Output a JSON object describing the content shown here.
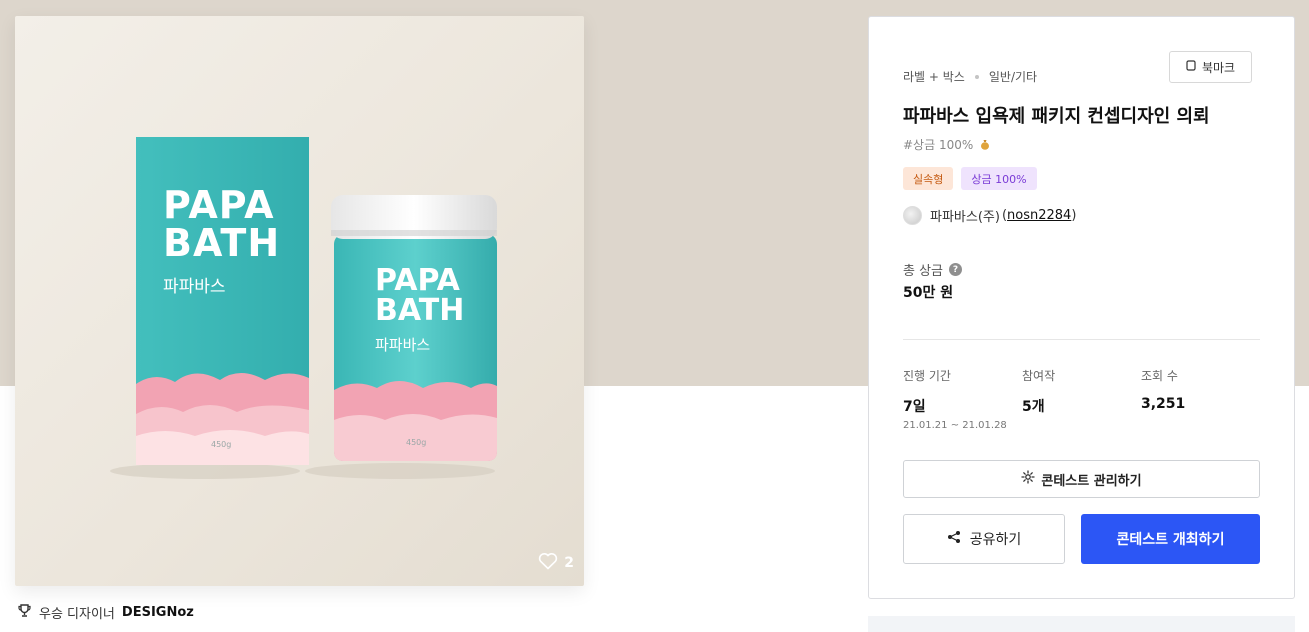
{
  "product": {
    "likes": "2",
    "winner_prefix": "우승 디자이너",
    "winner_name": "DESIGNoz",
    "box_brand_line1": "PAPA",
    "box_brand_line2": "BATH",
    "box_brand_korean": "파파바스",
    "box_weight": "450g"
  },
  "contest": {
    "category": "라벨 + 박스",
    "subcategory": "일반/기타",
    "bookmark_label": "북마크",
    "title": "파파바스 입욕제 패키지 컨셉디자인 의뢰",
    "hashtag": "#상금 100%",
    "tags": [
      "실속형",
      "상금 100%"
    ],
    "host_name": "파파바스(주)",
    "host_id_open": "(",
    "host_id": "nosn2284",
    "host_id_close": ")",
    "prize_label": "총 상금",
    "prize_value": "50만 원",
    "stats": [
      {
        "label": "진행 기간",
        "value": "7일",
        "sub": "21.01.21 ~ 21.01.28"
      },
      {
        "label": "참여작",
        "value": "5개"
      },
      {
        "label": "조회 수",
        "value": "3,251"
      }
    ],
    "manage_button": "콘테스트 관리하기",
    "share_button": "공유하기",
    "host_button": "콘테스트 개최하기"
  },
  "colors": {
    "hero_background": "#ddd6cc",
    "primary": "#2c56f5",
    "product_teal": "#3fbdbb",
    "product_pink": "#f2a3b3"
  },
  "icons": [
    "heart-icon",
    "trophy-icon",
    "bookmark-icon",
    "question-icon",
    "gear-icon",
    "share-icon"
  ]
}
